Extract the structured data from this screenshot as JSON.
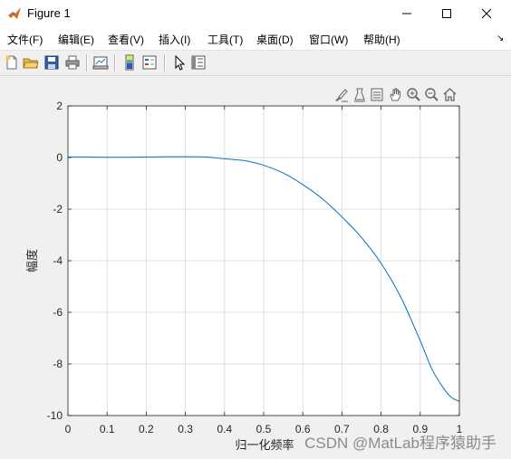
{
  "window": {
    "title": "Figure 1"
  },
  "menu": {
    "items": [
      "文件(F)",
      "编辑(E)",
      "查看(V)",
      "插入(I)",
      "工具(T)",
      "桌面(D)",
      "窗口(W)",
      "帮助(H)"
    ],
    "overflow": "↘"
  },
  "toolbar": {
    "icons": [
      "new-figure-icon",
      "open-file-icon",
      "save-icon",
      "print-icon",
      "link-plot-icon",
      "insert-colorbar-icon",
      "insert-legend-icon",
      "edit-plot-icon",
      "property-inspector-icon"
    ]
  },
  "axes_toolbar": {
    "icons": [
      "brush-icon",
      "data-tips-icon",
      "export-icon",
      "pan-icon",
      "zoom-in-icon",
      "zoom-out-icon",
      "home-icon"
    ]
  },
  "chart_data": {
    "type": "line",
    "xlabel": "归一化频率",
    "ylabel": "幅度",
    "xlim": [
      0,
      1
    ],
    "ylim": [
      -10,
      2
    ],
    "xticks": [
      "0",
      "0.1",
      "0.2",
      "0.3",
      "0.4",
      "0.5",
      "0.6",
      "0.7",
      "0.8",
      "0.9",
      "1"
    ],
    "yticks": [
      "2",
      "0",
      "-2",
      "-4",
      "-6",
      "-8",
      "-10"
    ],
    "grid": true,
    "line_color": "#0072bd",
    "series": [
      {
        "x": [
          0,
          0.05,
          0.1,
          0.15,
          0.2,
          0.25,
          0.3,
          0.35,
          0.4,
          0.45,
          0.5,
          0.55,
          0.6,
          0.65,
          0.7,
          0.75,
          0.8,
          0.85,
          0.9,
          0.93,
          0.96,
          0.98,
          1.0
        ],
        "values": [
          0.02,
          0.02,
          0.01,
          0.01,
          0.02,
          0.03,
          0.03,
          0.02,
          -0.05,
          -0.12,
          -0.3,
          -0.6,
          -1.05,
          -1.6,
          -2.3,
          -3.1,
          -4.1,
          -5.4,
          -7.1,
          -8.2,
          -8.95,
          -9.3,
          -9.45
        ]
      }
    ]
  },
  "watermark": "CSDN @MatLab程序猿助手"
}
